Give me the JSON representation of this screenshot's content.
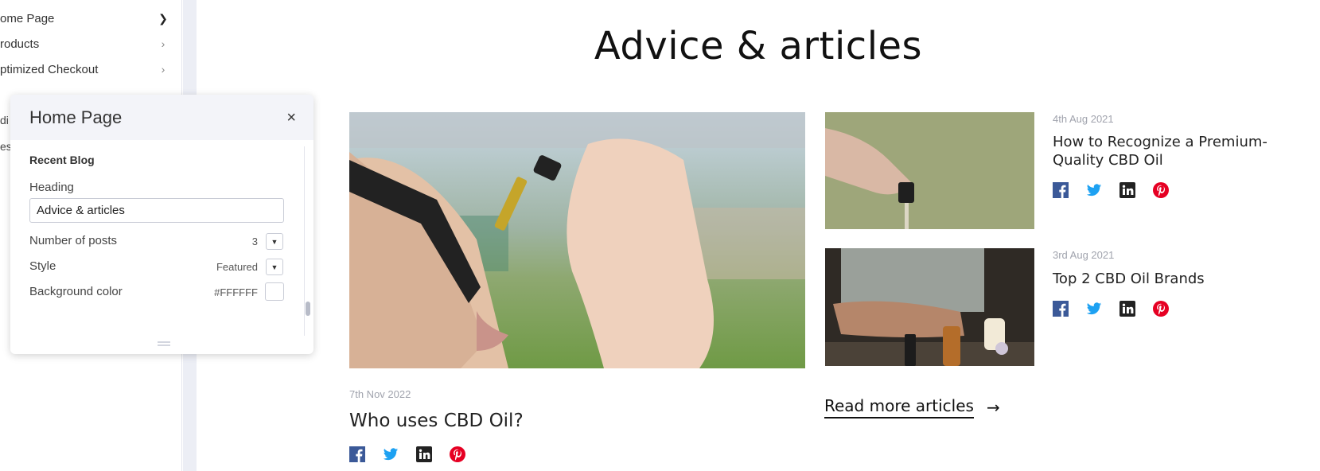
{
  "sidebar": {
    "items": [
      {
        "label": "ome Page"
      },
      {
        "label": "roducts"
      },
      {
        "label": "ptimized Checkout"
      }
    ],
    "clipped_items": [
      "di",
      "es"
    ]
  },
  "panel": {
    "title": "Home Page",
    "close_icon": "×",
    "section": "Recent Blog",
    "heading_label": "Heading",
    "heading_value": "Advice & articles",
    "rows": [
      {
        "label": "Number of posts",
        "value": "3"
      },
      {
        "label": "Style",
        "value": "Featured"
      },
      {
        "label": "Background color",
        "value": "#FFFFFF"
      }
    ]
  },
  "content": {
    "heading": "Advice & articles",
    "featured": {
      "date": "7th Nov 2022",
      "title": "Who uses CBD Oil?"
    },
    "posts": [
      {
        "date": "4th Aug 2021",
        "title_line1": "How to Recognize a Premium-",
        "title_line2": "Quality CBD Oil"
      },
      {
        "date": "3rd Aug 2021",
        "title_line1": "Top 2 CBD Oil Brands",
        "title_line2": ""
      }
    ],
    "read_more": "Read more articles",
    "arrow": "→"
  },
  "colors": {
    "facebook": "#3b5998",
    "twitter": "#1da1f2",
    "linkedin": "#222222",
    "pinterest": "#e60023"
  }
}
